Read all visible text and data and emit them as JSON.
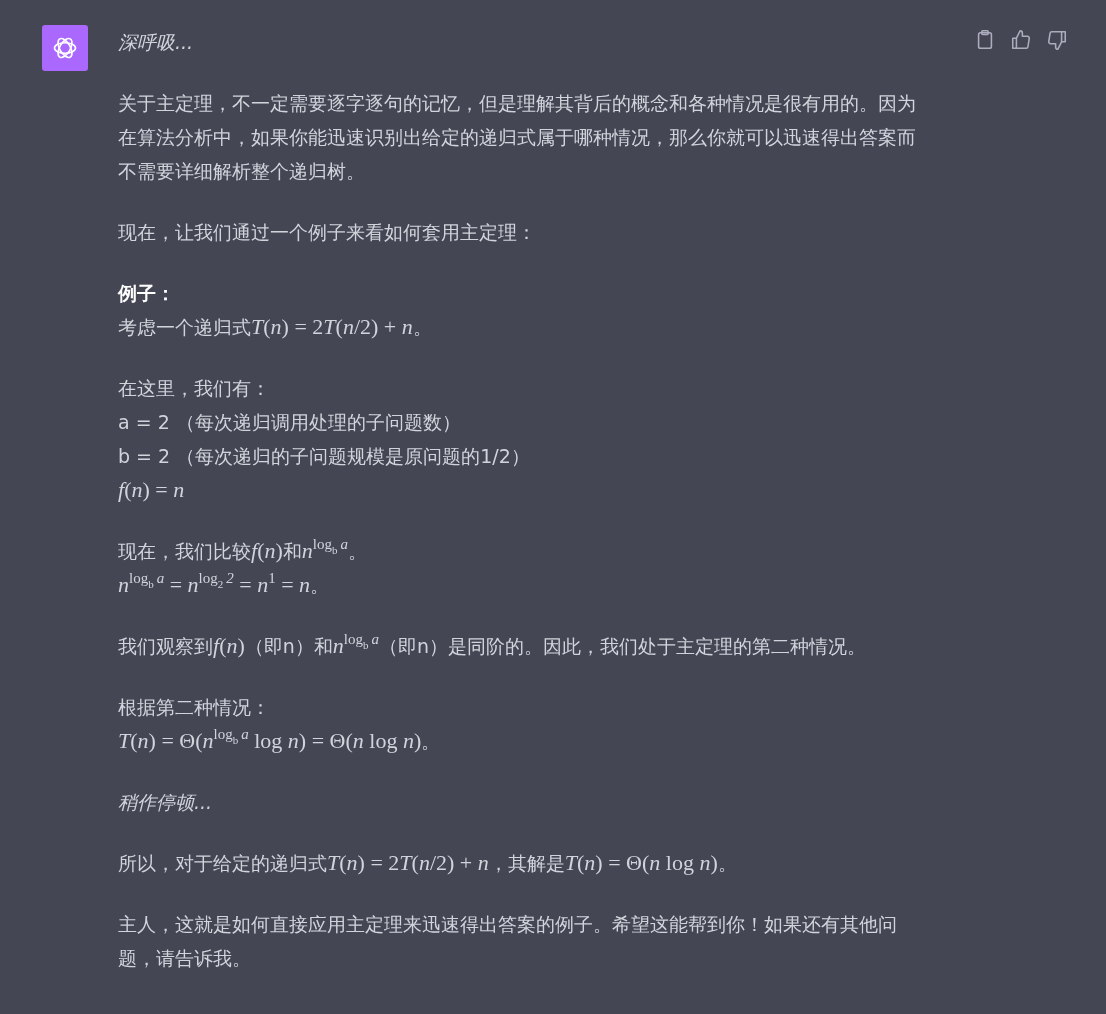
{
  "message": {
    "header": "深呼吸...",
    "paragraphs": [
      {
        "kind": "text",
        "lines": [
          [
            {
              "kind": "text",
              "text": "关于主定理，不一定需要逐字逐句的记忆，但是理解其背后的概念和各种情况是很有用的。因为在算法分析中，如果你能迅速识别出给定的递归式属于哪种情况，那么你就可以迅速得出答案而不需要详细解析整个递归树。"
            }
          ]
        ]
      },
      {
        "kind": "text",
        "lines": [
          [
            {
              "kind": "text",
              "text": "现在，让我们通过一个例子来看如何套用主定理："
            }
          ]
        ]
      },
      {
        "kind": "text",
        "lines": [
          [
            {
              "kind": "bold",
              "text": "例子："
            }
          ],
          [
            {
              "kind": "text",
              "text": "考虑一个递归式"
            },
            {
              "kind": "var",
              "text": "T"
            },
            {
              "kind": "math",
              "text": "("
            },
            {
              "kind": "var",
              "text": "n"
            },
            {
              "kind": "math",
              "text": ") = 2"
            },
            {
              "kind": "var",
              "text": "T"
            },
            {
              "kind": "math",
              "text": "("
            },
            {
              "kind": "var",
              "text": "n"
            },
            {
              "kind": "math",
              "text": "/2) + "
            },
            {
              "kind": "var",
              "text": "n"
            },
            {
              "kind": "text",
              "text": "。"
            }
          ]
        ]
      },
      {
        "kind": "text",
        "lines": [
          [
            {
              "kind": "text",
              "text": "在这里，我们有："
            }
          ],
          [
            {
              "kind": "text",
              "text": "a = 2 （每次递归调用处理的子问题数）"
            }
          ],
          [
            {
              "kind": "text",
              "text": "b = 2 （每次递归的子问题规模是原问题的1/2）"
            }
          ],
          [
            {
              "kind": "var",
              "text": "f"
            },
            {
              "kind": "math",
              "text": "("
            },
            {
              "kind": "var",
              "text": "n"
            },
            {
              "kind": "math",
              "text": ") = "
            },
            {
              "kind": "var",
              "text": "n"
            }
          ]
        ]
      },
      {
        "kind": "text",
        "lines": [
          [
            {
              "kind": "text",
              "text": "现在，我们比较"
            },
            {
              "kind": "var",
              "text": "f"
            },
            {
              "kind": "math",
              "text": "("
            },
            {
              "kind": "var",
              "text": "n"
            },
            {
              "kind": "math",
              "text": ")"
            },
            {
              "kind": "text",
              "text": "和"
            },
            {
              "kind": "pow",
              "base": "n",
              "exponent": "$^{log}$",
              "index": "$_{b}$",
              "argument": "$^{a}$"
            },
            {
              "kind": "text",
              "text": "。"
            }
          ],
          [
            {
              "kind": "pow",
              "base": "n",
              "exponent": "$^{log}$",
              "index": "$_{b}$",
              "argument": "$^{a}$"
            },
            {
              "kind": "math",
              "text": " = "
            },
            {
              "kind": "pow",
              "base": "n",
              "exponent": "$^{log}$",
              "index": "$_{2}$",
              "argument": "$^{2}$"
            },
            {
              "kind": "math",
              "text": " = "
            },
            {
              "kind": "pow",
              "base": "n",
              "exponent": "$^{1}$"
            },
            {
              "kind": "math",
              "text": " = "
            },
            {
              "kind": "var",
              "text": "n"
            },
            {
              "kind": "text",
              "text": "。"
            }
          ]
        ]
      },
      {
        "kind": "text",
        "lines": [
          [
            {
              "kind": "text",
              "text": "我们观察到"
            },
            {
              "kind": "var",
              "text": "f"
            },
            {
              "kind": "math",
              "text": "("
            },
            {
              "kind": "var",
              "text": "n"
            },
            {
              "kind": "math",
              "text": ")"
            },
            {
              "kind": "text",
              "text": "（即n）和"
            },
            {
              "kind": "pow",
              "base": "n",
              "exponent": "$^{log}$",
              "index": "$_{b}$",
              "argument": "$^{a}$"
            },
            {
              "kind": "text",
              "text": "（即n）是同阶的。因此，我们处于主定理的第二种情况。"
            }
          ]
        ]
      },
      {
        "kind": "text",
        "lines": [
          [
            {
              "kind": "text",
              "text": "根据第二种情况："
            }
          ],
          [
            {
              "kind": "var",
              "text": "T"
            },
            {
              "kind": "math",
              "text": "("
            },
            {
              "kind": "var",
              "text": "n"
            },
            {
              "kind": "math",
              "text": ") = Θ("
            },
            {
              "kind": "pow",
              "base": "n",
              "exponent": "$^{log}$",
              "index": "$_{b}$",
              "argument": "$^{a}$"
            },
            {
              "kind": "math",
              "text": " log "
            },
            {
              "kind": "var",
              "text": "n"
            },
            {
              "kind": "math",
              "text": ") = Θ("
            },
            {
              "kind": "var",
              "text": "n"
            },
            {
              "kind": "math",
              "text": " log "
            },
            {
              "kind": "var",
              "text": "n"
            },
            {
              "kind": "math",
              "text": ")"
            },
            {
              "kind": "text",
              "text": "。"
            }
          ]
        ]
      },
      {
        "kind": "italic",
        "lines": [
          [
            {
              "kind": "text",
              "text": "稍作停顿..."
            }
          ]
        ]
      },
      {
        "kind": "text",
        "lines": [
          [
            {
              "kind": "text",
              "text": "所以，对于给定的递归式"
            },
            {
              "kind": "var",
              "text": "T"
            },
            {
              "kind": "math",
              "text": "("
            },
            {
              "kind": "var",
              "text": "n"
            },
            {
              "kind": "math",
              "text": ") = 2"
            },
            {
              "kind": "var",
              "text": "T"
            },
            {
              "kind": "math",
              "text": "("
            },
            {
              "kind": "var",
              "text": "n"
            },
            {
              "kind": "math",
              "text": "/2) + "
            },
            {
              "kind": "var",
              "text": "n"
            },
            {
              "kind": "text",
              "text": "，其解是"
            },
            {
              "kind": "var",
              "text": "T"
            },
            {
              "kind": "math",
              "text": "("
            },
            {
              "kind": "var",
              "text": "n"
            },
            {
              "kind": "math",
              "text": ") = Θ("
            },
            {
              "kind": "var",
              "text": "n"
            },
            {
              "kind": "math",
              "text": " log "
            },
            {
              "kind": "var",
              "text": "n"
            },
            {
              "kind": "math",
              "text": ")"
            },
            {
              "kind": "text",
              "text": "。"
            }
          ]
        ]
      },
      {
        "kind": "text",
        "lines": [
          [
            {
              "kind": "text",
              "text": "主人，这就是如何直接应用主定理来迅速得出答案的例子。希望这能帮到你！如果还有其他问题，请告诉我。"
            }
          ]
        ]
      }
    ]
  }
}
